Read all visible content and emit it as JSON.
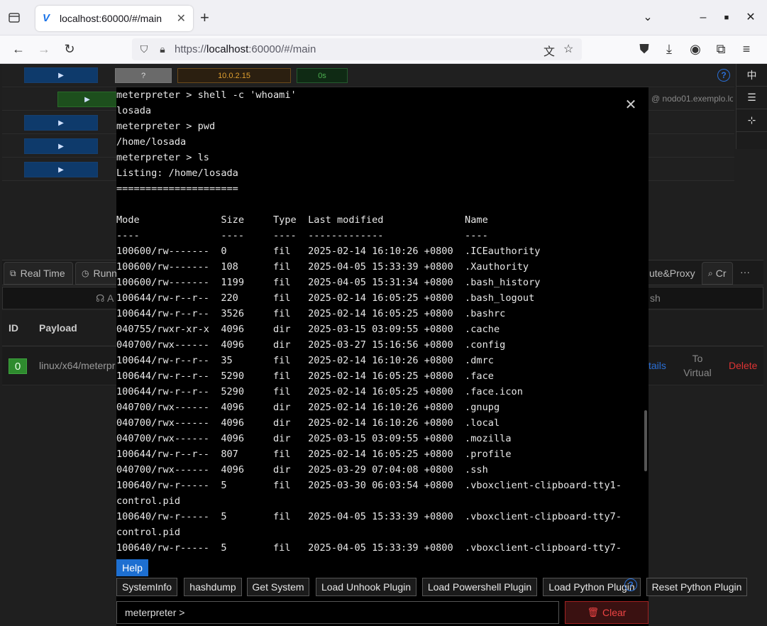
{
  "browser": {
    "tab_title": "localhost:60000/#/main",
    "tab_favicon": "V",
    "url_prefix": "https://",
    "url_host": "localhost",
    "url_rest": ":60000/#/main"
  },
  "app": {
    "host_ip": "10.0.2.15",
    "timer": "0s",
    "gray_pill": "?",
    "node_label": "@ nodo01.exemplo.lo",
    "side_lang": "中",
    "tabs": {
      "real_time": "Real Time",
      "running": "Runn",
      "route_proxy": "ute&Proxy",
      "cr": "Cr",
      "more": "···"
    },
    "subbar": {
      "left": "A",
      "right": "sh"
    },
    "table": {
      "headers": {
        "id": "ID",
        "payload": "Payload"
      },
      "row": {
        "id": "0",
        "payload": "linux/x64/meterpr",
        "details": "tails",
        "to_virtual": "To\nVirtual",
        "delete": "Delete"
      }
    }
  },
  "terminal": {
    "lines": [
      "meterpreter > shell -c 'whoami'",
      "losada",
      "meterpreter > pwd",
      "/home/losada",
      "meterpreter > ls",
      "Listing: /home/losada",
      "=====================",
      "",
      "Mode              Size     Type  Last modified              Name",
      "----              ----     ----  -------------              ----",
      "100600/rw-------  0        fil   2025-02-14 16:10:26 +0800  .ICEauthority",
      "100600/rw-------  108      fil   2025-04-05 15:33:39 +0800  .Xauthority",
      "100600/rw-------  1199     fil   2025-04-05 15:31:34 +0800  .bash_history",
      "100644/rw-r--r--  220      fil   2025-02-14 16:05:25 +0800  .bash_logout",
      "100644/rw-r--r--  3526     fil   2025-02-14 16:05:25 +0800  .bashrc",
      "040755/rwxr-xr-x  4096     dir   2025-03-15 03:09:55 +0800  .cache",
      "040700/rwx------  4096     dir   2025-03-27 15:16:56 +0800  .config",
      "100644/rw-r--r--  35       fil   2025-02-14 16:10:26 +0800  .dmrc",
      "100644/rw-r--r--  5290     fil   2025-02-14 16:05:25 +0800  .face",
      "100644/rw-r--r--  5290     fil   2025-02-14 16:05:25 +0800  .face.icon",
      "040700/rwx------  4096     dir   2025-02-14 16:10:26 +0800  .gnupg",
      "040700/rwx------  4096     dir   2025-02-14 16:10:26 +0800  .local",
      "040700/rwx------  4096     dir   2025-03-15 03:09:55 +0800  .mozilla",
      "100644/rw-r--r--  807      fil   2025-02-14 16:05:25 +0800  .profile",
      "040700/rwx------  4096     dir   2025-03-29 07:04:08 +0800  .ssh",
      "100640/rw-r-----  5        fil   2025-03-30 06:03:54 +0800  .vboxclient-clipboard-tty1-",
      "control.pid",
      "100640/rw-r-----  5        fil   2025-04-05 15:33:39 +0800  .vboxclient-clipboard-tty7-",
      "control.pid",
      "100640/rw-r-----  5        fil   2025-04-05 15:33:39 +0800  .vboxclient-clipboard-tty7-"
    ],
    "help_label": "Help",
    "buttons": [
      "SystemInfo",
      "hashdump",
      "Get System",
      "Load Unhook Plugin",
      "Load Powershell Plugin",
      "Load Python Plugin",
      "Reset Python Plugin"
    ],
    "prompt_placeholder": "meterpreter >",
    "clear_label": "Clear"
  },
  "colors": {
    "accent": "#1d6fd1",
    "danger": "#e44444",
    "success": "#2e8b2e",
    "ip_text": "#e0a030"
  },
  "icons": {
    "close": "close-icon",
    "trash": "trash-icon",
    "help": "question-icon"
  }
}
